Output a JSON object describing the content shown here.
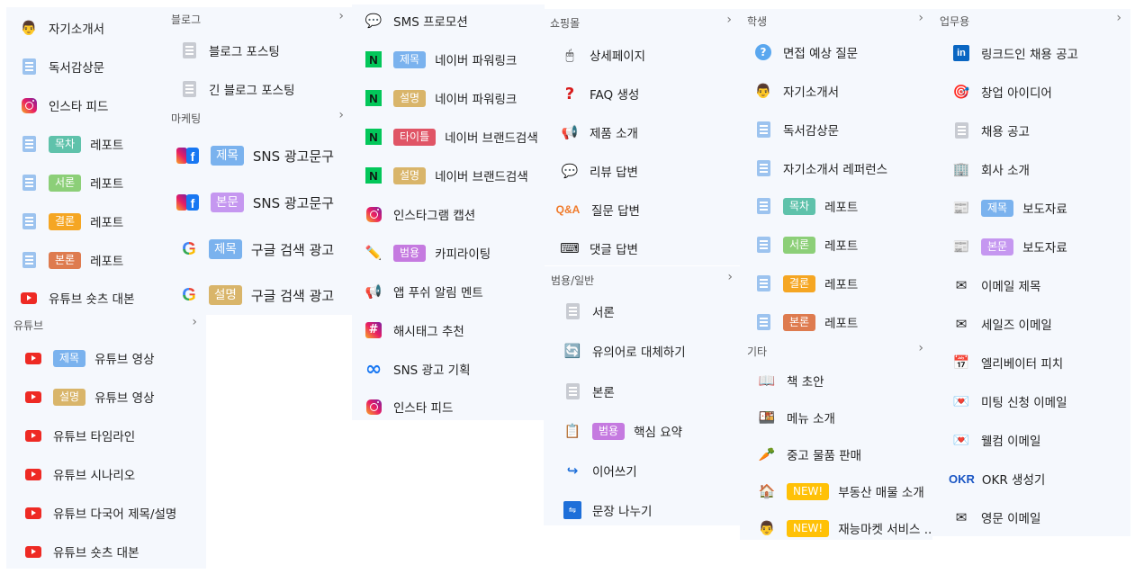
{
  "colors": {
    "panel_bg": "#f5f8fd",
    "badge_blue": "#7ab2ee",
    "badge_tan": "#d9b56a",
    "badge_red": "#e05566",
    "badge_purple": "#c57ae0",
    "badge_teal": "#5fc2ab",
    "badge_green": "#8ccf78",
    "badge_orange": "#f5a623",
    "badge_brown": "#de7b4f",
    "badge_lilac": "#c597f0",
    "badge_new": "#ffc107"
  },
  "col1": {
    "items": [
      {
        "icon": "person-icon",
        "label": "자기소개서"
      },
      {
        "icon": "document-icon",
        "label": "독서감상문"
      },
      {
        "icon": "instagram-icon",
        "label": "인스타 피드"
      },
      {
        "icon": "document-icon",
        "badge": "목차",
        "label": "레포트"
      },
      {
        "icon": "document-icon",
        "badge": "서론",
        "label": "레포트"
      },
      {
        "icon": "document-icon",
        "badge": "결론",
        "label": "레포트"
      },
      {
        "icon": "document-icon",
        "badge": "본론",
        "label": "레포트"
      },
      {
        "icon": "youtube-icon",
        "label": "유튜브 숏츠 대본"
      }
    ],
    "youtube_header": "유튜브",
    "youtube_items": [
      {
        "icon": "youtube-icon",
        "badge": "제목",
        "label": "유튜브 영상"
      },
      {
        "icon": "youtube-icon",
        "badge": "설명",
        "label": "유튜브 영상"
      },
      {
        "icon": "youtube-icon",
        "label": "유튜브 타임라인"
      },
      {
        "icon": "youtube-icon",
        "label": "유튜브 시나리오"
      },
      {
        "icon": "youtube-icon",
        "label": "유튜브 다국어 제목/설명"
      },
      {
        "icon": "youtube-icon",
        "label": "유튜브 숏츠 대본"
      }
    ]
  },
  "col2": {
    "blog_header": "블로그",
    "blog_items": [
      {
        "icon": "blog-document-icon",
        "label": "블로그 포스팅"
      },
      {
        "icon": "long-document-icon",
        "label": "긴 블로그 포스팅"
      }
    ],
    "marketing_header": "마케팅",
    "marketing_items": [
      {
        "icon": "instagram-facebook-icon",
        "badge": "제목",
        "label": "SNS 광고문구"
      },
      {
        "icon": "instagram-facebook-icon",
        "badge": "본문",
        "label": "SNS 광고문구"
      },
      {
        "icon": "google-icon",
        "badge": "제목",
        "label": "구글 검색 광고"
      },
      {
        "icon": "google-icon",
        "badge": "설명",
        "label": "구글 검색 광고"
      }
    ],
    "google_glyph": "G",
    "facebook_glyph": "f"
  },
  "col3": {
    "items": [
      {
        "icon": "chat-bubble-icon",
        "label": "SMS 프로모션"
      },
      {
        "icon": "naver-icon",
        "badge": "제목",
        "label": "네이버 파워링크"
      },
      {
        "icon": "naver-icon",
        "badge": "설명",
        "label": "네이버 파워링크"
      },
      {
        "icon": "naver-icon",
        "badge": "타이틀",
        "label": "네이버 브랜드검색"
      },
      {
        "icon": "naver-icon",
        "badge": "설명",
        "label": "네이버 브랜드검색"
      },
      {
        "icon": "instagram-icon",
        "label": "인스타그램 캡션"
      },
      {
        "icon": "pencil-icon",
        "badge": "범용",
        "label": "카피라이팅"
      },
      {
        "icon": "megaphone-icon",
        "label": "앱 푸쉬 알림 멘트"
      },
      {
        "icon": "hashtag-icon",
        "label": "해시태그 추천"
      },
      {
        "icon": "meta-icon",
        "label": "SNS 광고 기획"
      },
      {
        "icon": "instagram-icon",
        "label": "인스타 피드"
      }
    ],
    "naver_glyph": "N",
    "meta_glyph": "∞",
    "hash_glyph": "#"
  },
  "col4": {
    "shopping_header": "쇼핑몰",
    "shopping_items": [
      {
        "icon": "cursor-page-icon",
        "label": "상세페이지"
      },
      {
        "icon": "question-mark-icon",
        "label": "FAQ 생성"
      },
      {
        "icon": "megaphone-icon",
        "label": "제품 소개"
      },
      {
        "icon": "speech-bubble-icon",
        "label": "리뷰 답변"
      },
      {
        "icon": "qa-icon",
        "label": "질문 답변"
      },
      {
        "icon": "keyboard-icon",
        "label": "댓글 답변"
      }
    ],
    "qa_glyph": "Q&A",
    "question_glyph": "?",
    "general_header": "범용/일반",
    "general_items": [
      {
        "icon": "document-icon",
        "label": "서론"
      },
      {
        "icon": "refresh-icon",
        "label": "유의어로 대체하기"
      },
      {
        "icon": "document-icon",
        "label": "본론"
      },
      {
        "icon": "clipboard-icon",
        "badge": "범용",
        "label": "핵심 요약"
      },
      {
        "icon": "continue-arrow-icon",
        "label": "이어쓰기"
      },
      {
        "icon": "split-icon",
        "label": "문장 나누기"
      }
    ]
  },
  "col5": {
    "student_header": "학생",
    "student_items": [
      {
        "icon": "question-bubble-icon",
        "label": "면접 예상 질문"
      },
      {
        "icon": "person-icon",
        "label": "자기소개서"
      },
      {
        "icon": "document-icon",
        "label": "독서감상문"
      },
      {
        "icon": "document-icon",
        "label": "자기소개서 레퍼런스"
      },
      {
        "icon": "document-icon",
        "badge": "목차",
        "label": "레포트"
      },
      {
        "icon": "document-icon",
        "badge": "서론",
        "label": "레포트"
      },
      {
        "icon": "document-icon",
        "badge": "결론",
        "label": "레포트"
      },
      {
        "icon": "document-icon",
        "badge": "본론",
        "label": "레포트"
      }
    ],
    "etc_header": "기타",
    "etc_items": [
      {
        "icon": "book-icon",
        "label": "책 초안"
      },
      {
        "icon": "food-icon",
        "label": "메뉴 소개"
      },
      {
        "icon": "carrot-icon",
        "label": "중고 물품 판매"
      },
      {
        "icon": "house-icon",
        "badge": "NEW!",
        "label": "부동산 매물 소개"
      },
      {
        "icon": "person-icon",
        "badge": "NEW!",
        "label": "재능마켓 서비스 ..."
      }
    ]
  },
  "col6": {
    "business_header": "업무용",
    "items": [
      {
        "icon": "linkedin-icon",
        "label": "링크드인 채용 공고"
      },
      {
        "icon": "target-icon",
        "label": "창업 아이디어"
      },
      {
        "icon": "document-icon",
        "label": "채용 공고"
      },
      {
        "icon": "building-icon",
        "label": "회사 소개"
      },
      {
        "icon": "newspaper-icon",
        "badge": "제목",
        "label": "보도자료"
      },
      {
        "icon": "newspaper-icon",
        "badge": "본문",
        "label": "보도자료"
      },
      {
        "icon": "envelope-icon",
        "label": "이메일 제목"
      },
      {
        "icon": "money-envelope-icon",
        "label": "세일즈 이메일"
      },
      {
        "icon": "calendar-icon",
        "label": "엘리베이터 피치"
      },
      {
        "icon": "heart-envelope-icon",
        "label": "미팅 신청 이메일"
      },
      {
        "icon": "heart-envelope-icon",
        "label": "웰컴 이메일"
      },
      {
        "icon": "okr-icon",
        "label": "OKR 생성기"
      },
      {
        "icon": "envelope-icon",
        "label": "영문 이메일"
      }
    ],
    "linkedin_glyph": "in",
    "okr_glyph": "OKR"
  },
  "chevron_glyph": "›"
}
